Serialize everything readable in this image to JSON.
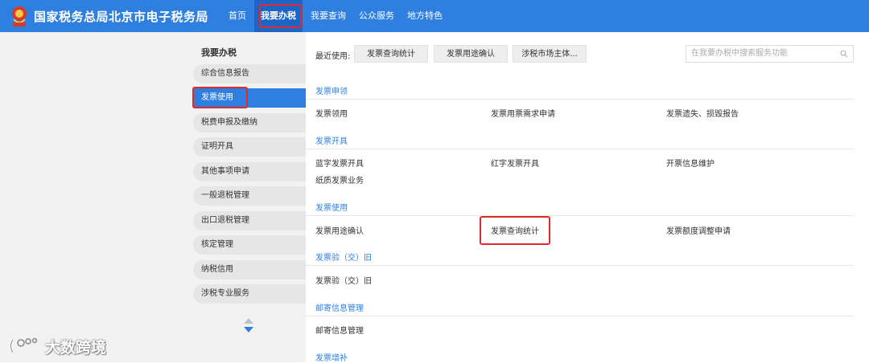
{
  "header": {
    "site_title": "国家税务总局北京市电子税务局",
    "nav": [
      "首页",
      "我要办税",
      "我要查询",
      "公众服务",
      "地方特色"
    ]
  },
  "sidebar": {
    "title": "我要办税",
    "items": [
      "综合信息报告",
      "发票使用",
      "税费申报及缴纳",
      "证明开具",
      "其他事项申请",
      "一般退税管理",
      "出口退税管理",
      "核定管理",
      "纳税信用",
      "涉税专业服务"
    ]
  },
  "recent": {
    "label": "最近使用:",
    "items": [
      "发票查询统计",
      "发票用途确认",
      "涉税市场主体..."
    ]
  },
  "search": {
    "placeholder": "在我要办税中搜索服务功能"
  },
  "sections": [
    {
      "title": "发票申领",
      "links": [
        "发票领用",
        "发票用票需求申请",
        "发票遗失、损毁报告"
      ]
    },
    {
      "title": "发票开具",
      "links": [
        "蓝字发票开具",
        "红字发票开具",
        "开票信息维护",
        "纸质发票业务"
      ]
    },
    {
      "title": "发票使用",
      "links": [
        "发票用途确认",
        "发票查询统计",
        "发票额度调整申请"
      ]
    },
    {
      "title": "发票验（交）旧",
      "links": [
        "发票验（交）旧"
      ]
    },
    {
      "title": "邮寄信息管理",
      "links": [
        "邮寄信息管理"
      ]
    },
    {
      "title": "发票增补",
      "links": []
    }
  ],
  "watermark": {
    "text": "大数跨境"
  },
  "colors": {
    "primary": "#2f7fe0",
    "nav_active": "#1e64c4",
    "highlight_box": "#e02b2b",
    "sidebar_bg": "#f2f2f2"
  }
}
